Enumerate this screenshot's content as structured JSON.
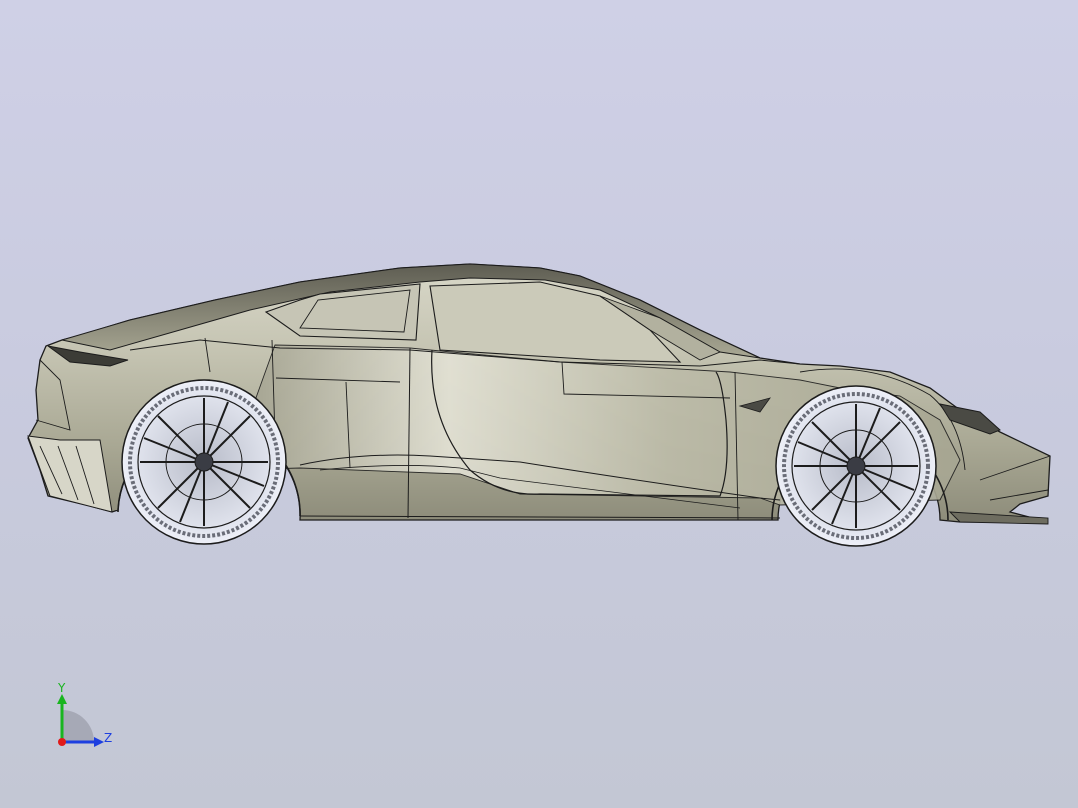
{
  "viewport": {
    "background_top": "#cfd0e6",
    "background_bottom": "#c3c7d4"
  },
  "model": {
    "body_color": "#b4b39f",
    "edge_color": "#1c1c1c",
    "icon": "sports-car-model"
  },
  "triad": {
    "y_label": "Y",
    "z_label": "Z",
    "y_color": "#19b51f",
    "z_color": "#1d3fe0",
    "x_color": "#e01a1a"
  }
}
